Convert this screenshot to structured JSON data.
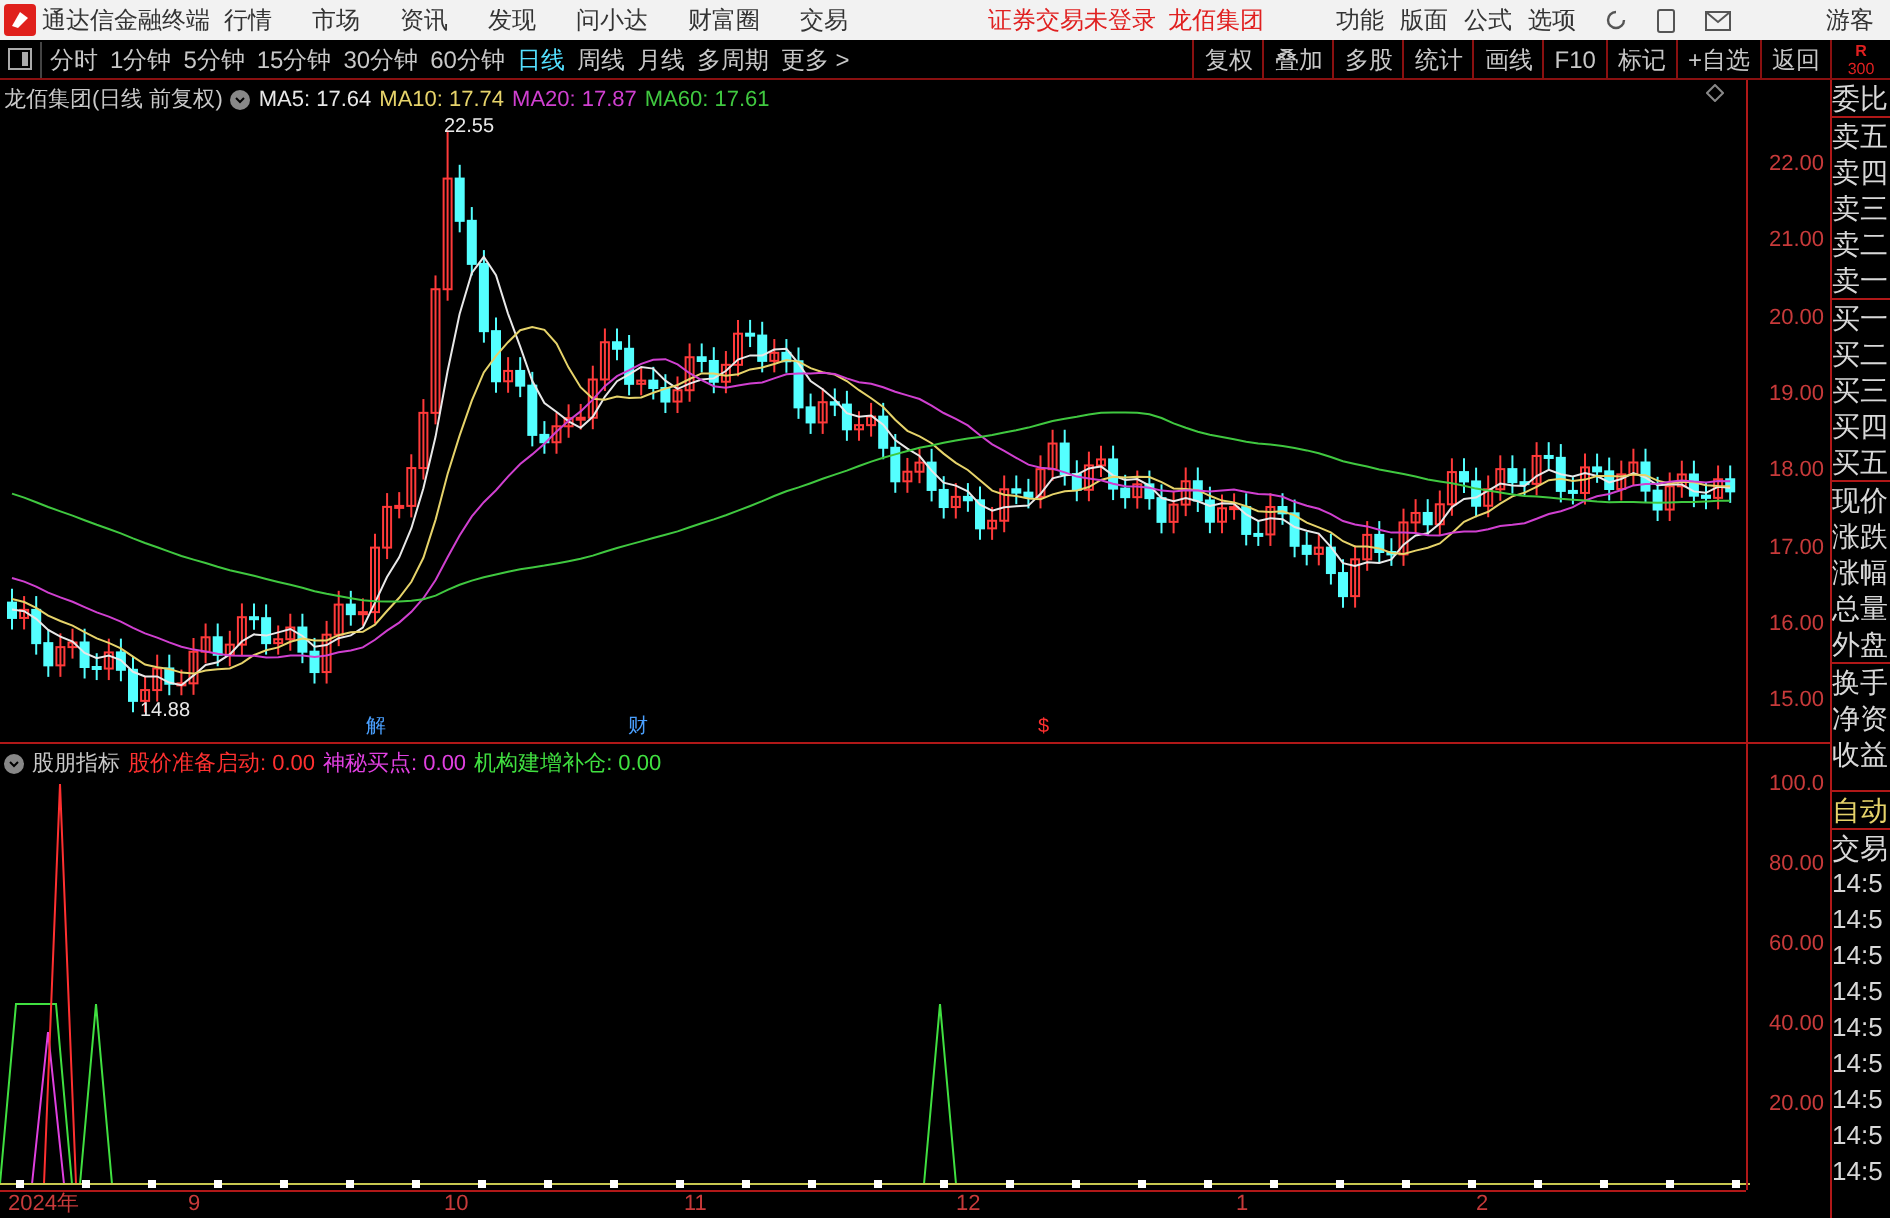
{
  "app": {
    "title": "通达信金融终端",
    "menu": [
      "行情",
      "市场",
      "资讯",
      "发现",
      "问小达",
      "财富圈",
      "交易"
    ],
    "notice": "证券交易未登录",
    "stock": "龙佰集团",
    "tools": [
      "功能",
      "版面",
      "公式",
      "选项"
    ],
    "user": "游客"
  },
  "periods": [
    {
      "label": "分时",
      "selected": false
    },
    {
      "label": "1分钟",
      "selected": false
    },
    {
      "label": "5分钟",
      "selected": false
    },
    {
      "label": "15分钟",
      "selected": false
    },
    {
      "label": "30分钟",
      "selected": false
    },
    {
      "label": "60分钟",
      "selected": false
    },
    {
      "label": "日线",
      "selected": true
    },
    {
      "label": "周线",
      "selected": false
    },
    {
      "label": "月线",
      "selected": false
    },
    {
      "label": "多周期",
      "selected": false
    },
    {
      "label": "更多 >",
      "selected": false
    }
  ],
  "actions": [
    "复权",
    "叠加",
    "多股",
    "统计",
    "画线",
    "F10",
    "标记",
    "+自选",
    "返回"
  ],
  "main_chart": {
    "title": "龙佰集团(日线 前复权)",
    "legend": [
      {
        "text": "MA5: 17.64",
        "color": "#e8e8e8"
      },
      {
        "text": "MA10: 17.74",
        "color": "#e6d36a"
      },
      {
        "text": "MA20: 17.87",
        "color": "#d040d0"
      },
      {
        "text": "MA60: 17.61",
        "color": "#40c840"
      }
    ],
    "high_label": "22.55",
    "low_label": "14.88",
    "yticks": [
      "22.00",
      "21.00",
      "20.00",
      "19.00",
      "18.00",
      "17.00",
      "16.00",
      "15.00"
    ],
    "event_marks": [
      {
        "text": "解",
        "color": "#4aa0ff"
      },
      {
        "text": "财",
        "color": "#4aa0ff"
      },
      {
        "text": "$",
        "color": "#ff3030"
      }
    ]
  },
  "indicator": {
    "title": "股朋指标",
    "legend": [
      {
        "text": "股价准备启动: 0.00",
        "color": "#ff3030"
      },
      {
        "text": "神秘买点: 0.00",
        "color": "#e040e0"
      },
      {
        "text": "机构建增补仓: 0.00",
        "color": "#40e040"
      }
    ],
    "yticks": [
      "100.0",
      "80.00",
      "60.00",
      "40.00",
      "20.00"
    ]
  },
  "date_axis": [
    "2024年",
    "9",
    "10",
    "11",
    "12",
    "1",
    "2"
  ],
  "side_panel": {
    "badge": [
      "R",
      "300"
    ],
    "rows": [
      "委比",
      "卖五",
      "卖四",
      "卖三",
      "卖二",
      "卖一",
      "买一",
      "买二",
      "买三",
      "买四",
      "买五",
      "现价",
      "涨跌",
      "涨幅",
      "总量",
      "外盘",
      "换手",
      "净资",
      "收益"
    ],
    "mode": "自动",
    "trade": "交易",
    "times": [
      "14:5",
      "14:5",
      "14:5",
      "14:5",
      "14:5",
      "14:5",
      "14:5",
      "14:5",
      "14:5"
    ]
  }
}
